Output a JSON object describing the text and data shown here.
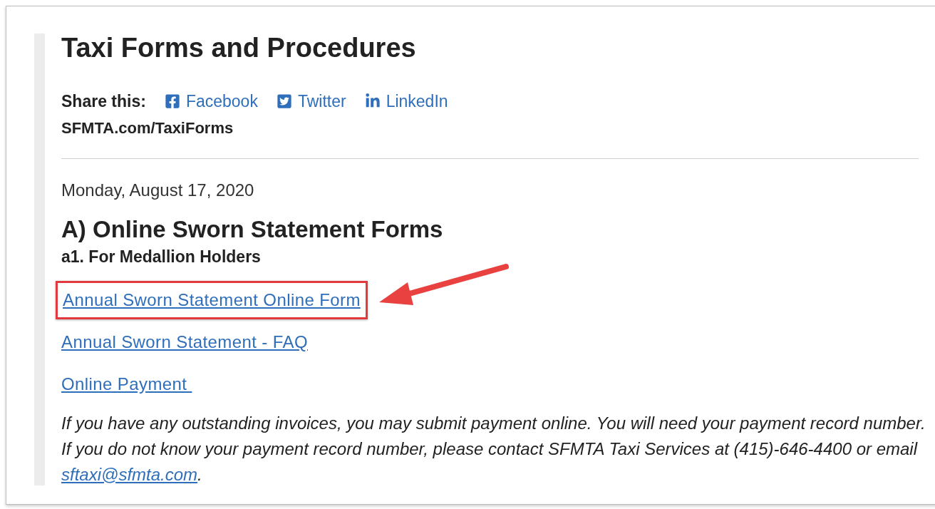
{
  "title": "Taxi Forms and Procedures",
  "share": {
    "label": "Share this:",
    "links": [
      {
        "kind": "facebook",
        "label": "Facebook"
      },
      {
        "kind": "twitter",
        "label": "Twitter"
      },
      {
        "kind": "linkedin",
        "label": "LinkedIn"
      }
    ]
  },
  "short_url": "SFMTA.com/TaxiForms",
  "date": "Monday, August 17, 2020",
  "section_heading": "A) Online Sworn Statement Forms",
  "subheading": "a1. For Medallion Holders",
  "links": [
    {
      "label": "Annual Sworn Statement Online Form",
      "highlighted": true
    },
    {
      "label": "Annual Sworn Statement - FAQ",
      "highlighted": false
    },
    {
      "label": "Online Payment ",
      "highlighted": false
    }
  ],
  "note": {
    "text": "If you have any outstanding invoices, you may submit payment online. You will need your payment record number. If you do not know your payment record number, please contact SFMTA Taxi Services at (415)-646-4400 or email ",
    "link": "sftaxi@sfmta.com",
    "end": "."
  }
}
